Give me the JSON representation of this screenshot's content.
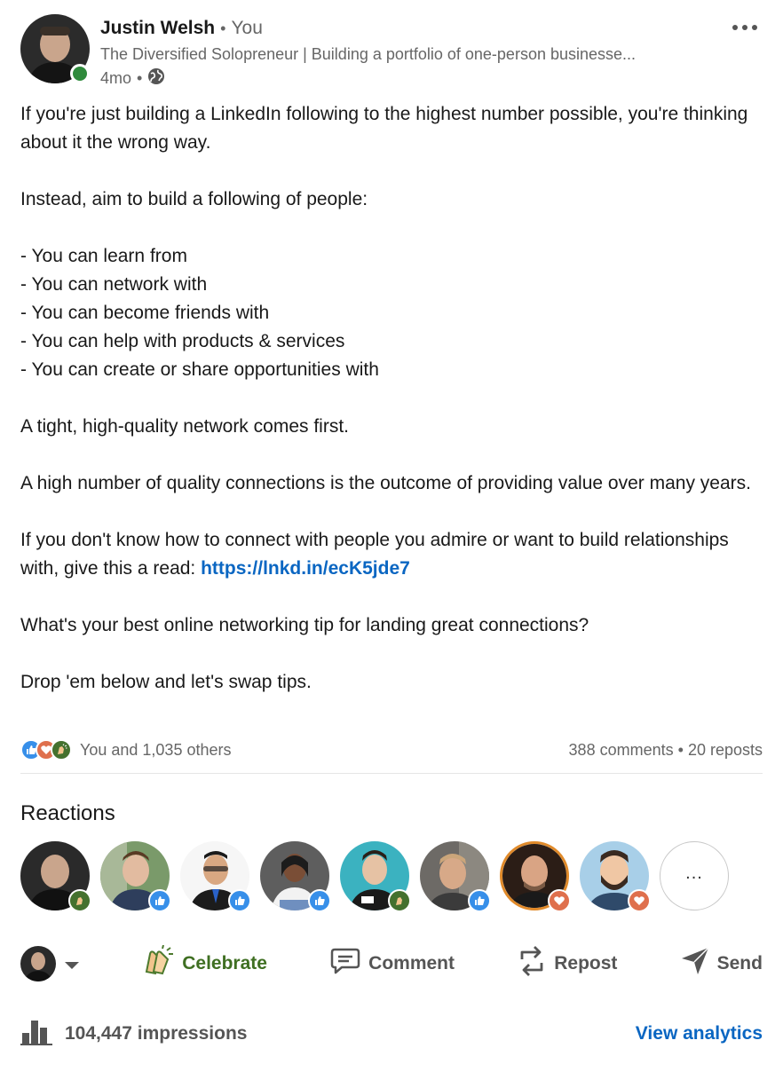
{
  "author": {
    "name": "Justin Welsh",
    "relation": "You",
    "headline": "The Diversified Solopreneur | Building a portfolio of one-person businesse...",
    "time": "4mo",
    "online": true
  },
  "post": {
    "text_before_link": "If you're just building a LinkedIn following to the highest number possible, you're thinking about it the wrong way.\n\nInstead, aim to build a following of people:\n\n- You can learn from\n- You can network with\n- You can become friends with\n- You can help with products & services\n- You can create or share opportunities with\n\nA tight, high-quality network comes first.\n\nA high number of quality connections is the outcome of providing value over many years.\n\nIf you don't know how to connect with people you admire or want to build relationships with, give this a read: ",
    "link": "https://lnkd.in/ecK5jde7",
    "text_after_link": "\n\nWhat's your best online networking tip for landing great connections?\n\nDrop 'em below and let's swap tips."
  },
  "social": {
    "reactions_summary": "You and 1,035 others",
    "comments": "388 comments",
    "reposts": "20 reposts",
    "reaction_icons": [
      "like-icon",
      "love-icon",
      "celebrate-icon"
    ]
  },
  "reactions": {
    "title": "Reactions",
    "more_label": "...",
    "people": [
      {
        "badge": "celebrate-icon",
        "bg": "#2a2a2a"
      },
      {
        "badge": "like-icon",
        "bg": "#6b8a5a"
      },
      {
        "badge": "like-icon",
        "bg": "#f4f4f4"
      },
      {
        "badge": "like-icon",
        "bg": "#5f5f5f"
      },
      {
        "badge": "celebrate-icon",
        "bg": "#3bb2c0"
      },
      {
        "badge": "like-icon",
        "bg": "#6d6a66"
      },
      {
        "badge": "love-icon",
        "bg": "#3a2a22"
      },
      {
        "badge": "love-icon",
        "bg": "#a8cfe8"
      }
    ]
  },
  "actions": {
    "celebrate": "Celebrate",
    "comment": "Comment",
    "repost": "Repost",
    "send": "Send"
  },
  "footer": {
    "impressions": "104,447 impressions",
    "analytics": "View analytics"
  },
  "colors": {
    "link": "#0a66c2",
    "like": "#378fe9",
    "love": "#df704d",
    "celebrate": "#44712e",
    "online": "#2f8a3c"
  }
}
